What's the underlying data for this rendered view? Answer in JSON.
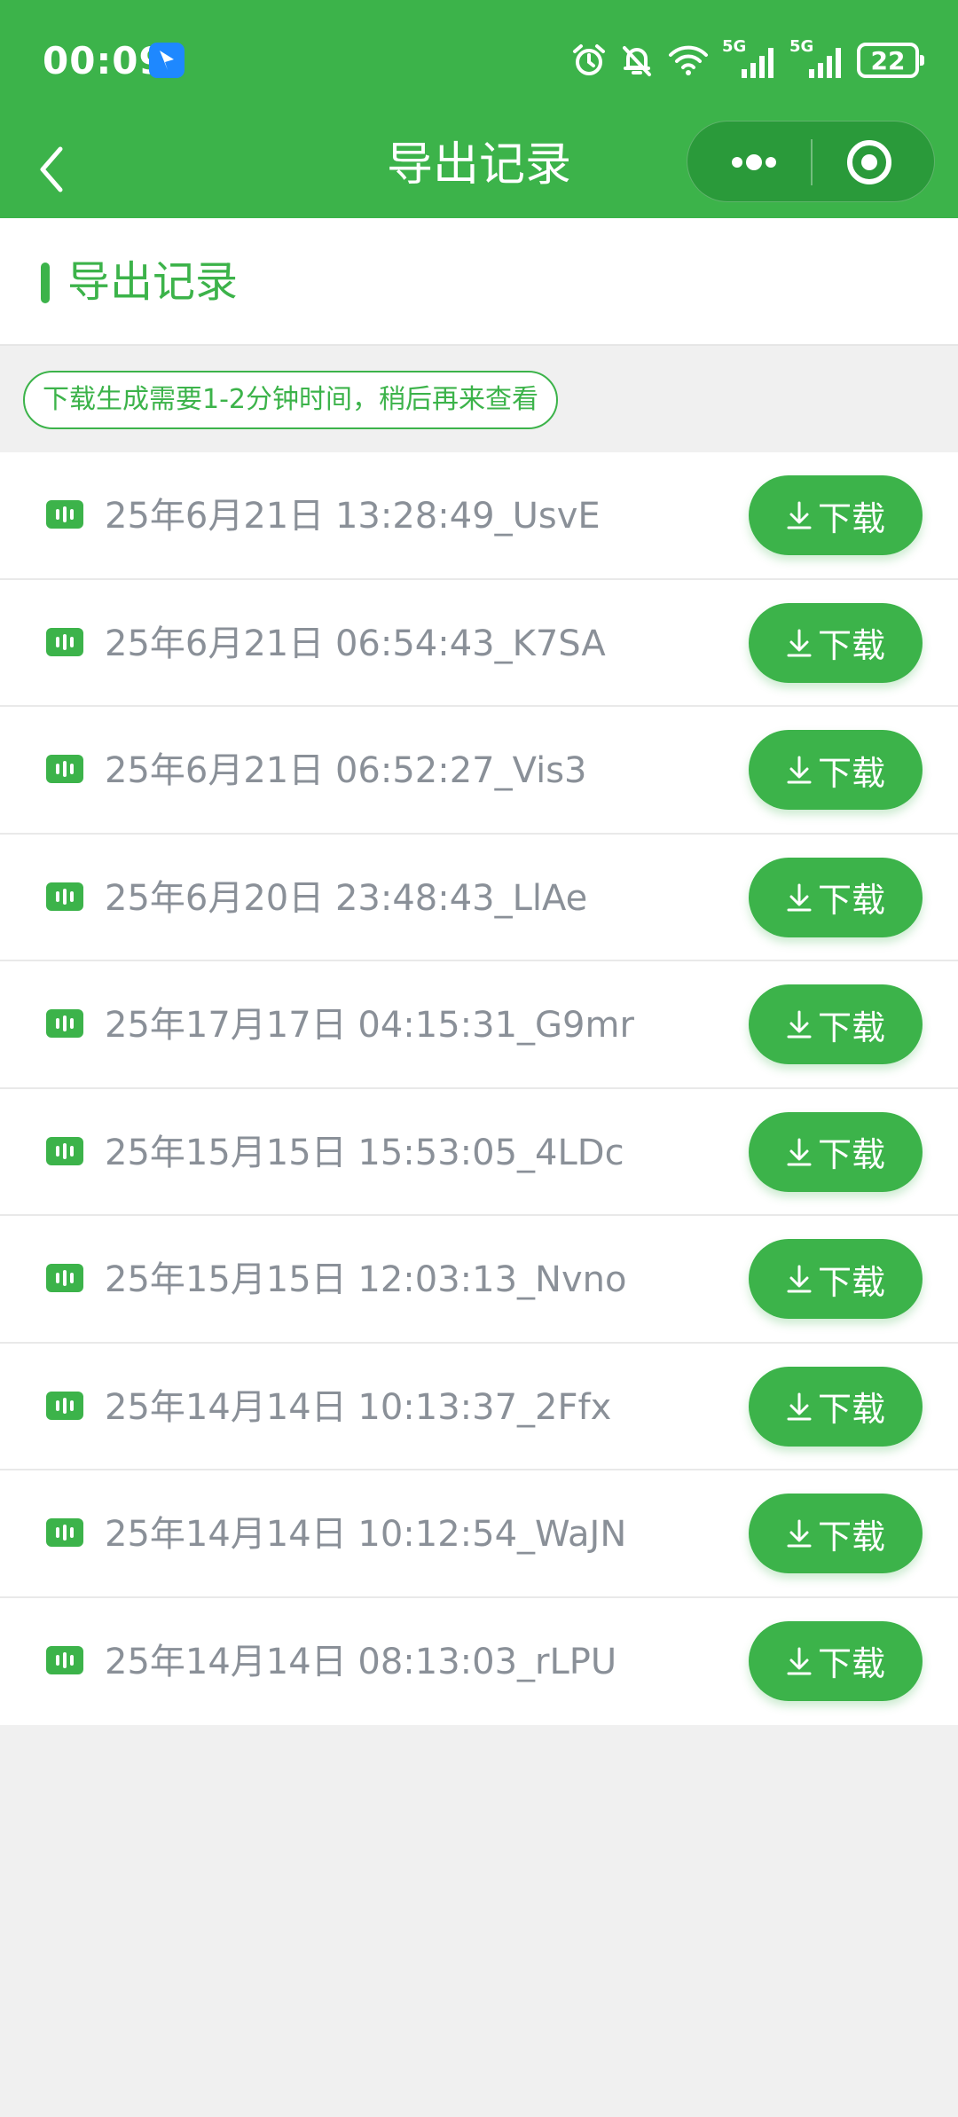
{
  "status_bar": {
    "time": "00:09",
    "battery": "22",
    "network_1": "5G",
    "network_2": "5G"
  },
  "nav": {
    "title": "导出记录"
  },
  "section": {
    "title": "导出记录"
  },
  "notice": "下载生成需要1-2分钟时间，稍后再来查看",
  "records": [
    {
      "name": "25年6月21日 13:28:49_UsvE",
      "button": "下载"
    },
    {
      "name": "25年6月21日 06:54:43_K7SA",
      "button": "下载"
    },
    {
      "name": "25年6月21日 06:52:27_Vis3",
      "button": "下载"
    },
    {
      "name": "25年6月20日 23:48:43_LlAe",
      "button": "下载"
    },
    {
      "name": "25年17月17日 04:15:31_G9mr",
      "button": "下载"
    },
    {
      "name": "25年15月15日 15:53:05_4LDc",
      "button": "下载"
    },
    {
      "name": "25年15月15日 12:03:13_Nvno",
      "button": "下载"
    },
    {
      "name": "25年14月14日 10:13:37_2Ffx",
      "button": "下载"
    },
    {
      "name": "25年14月14日 10:12:54_WaJN",
      "button": "下载"
    },
    {
      "name": "25年14月14日 08:13:03_rLPU",
      "button": "下载"
    }
  ],
  "colors": {
    "brand": "#3cb34a",
    "background": "#f0f0f0",
    "text_secondary": "#8a9098"
  }
}
